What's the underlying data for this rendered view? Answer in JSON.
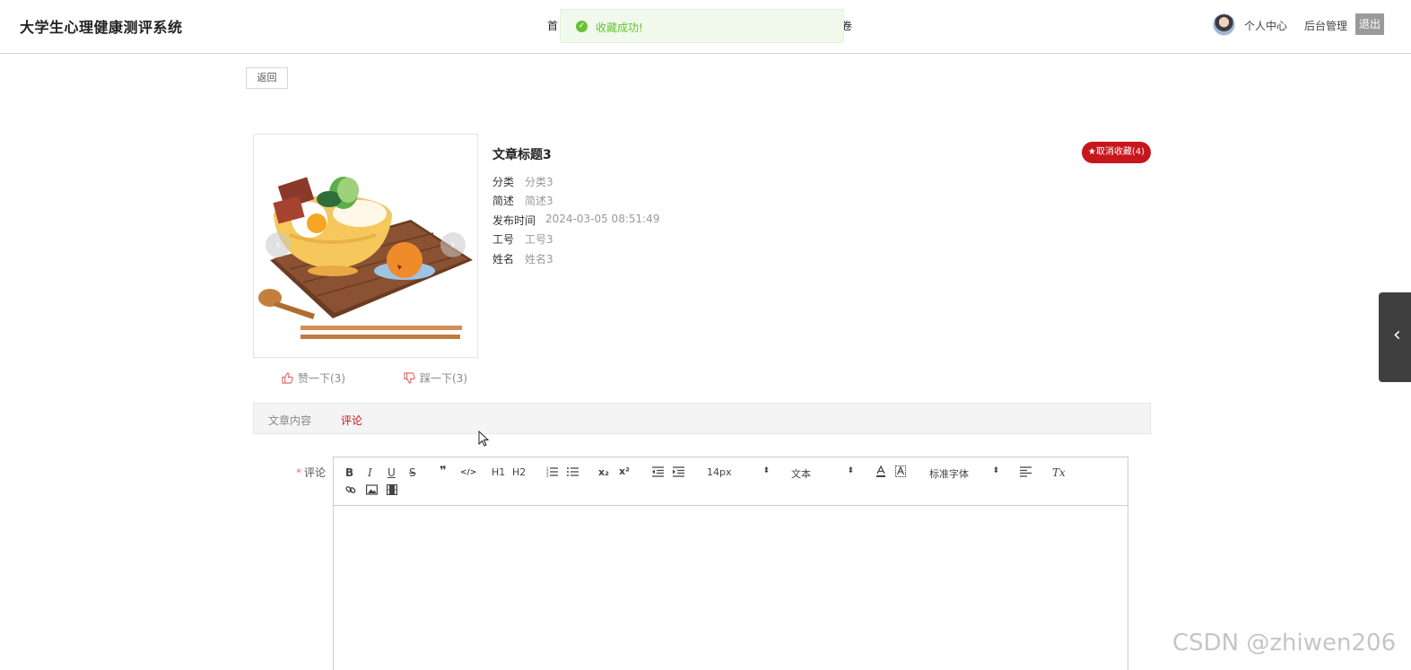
{
  "header": {
    "site_title": "大学生心理健康测评系统",
    "nav_left_fragment": "首",
    "nav_right_fragment": "卷",
    "profile_label": "个人中心",
    "admin_label": "后台管理",
    "logout_label": "退出"
  },
  "toast": {
    "icon": "check-circle-icon",
    "message": "收藏成功!"
  },
  "back_label": "返回",
  "article": {
    "title": "文章标题3",
    "favorite_badge": "★取消收藏(4)",
    "fields": [
      {
        "label": "分类",
        "value": "分类3"
      },
      {
        "label": "简述",
        "value": "简述3"
      },
      {
        "label": "发布时间",
        "value": "2024-03-05 08:51:49"
      },
      {
        "label": "工号",
        "value": "工号3"
      },
      {
        "label": "姓名",
        "value": "姓名3"
      }
    ]
  },
  "votes": {
    "up_label": "赞一下(3)",
    "down_label": "踩一下(3)"
  },
  "tabs": [
    {
      "label": "文章内容",
      "active": false
    },
    {
      "label": "评论",
      "active": true
    }
  ],
  "comment_form": {
    "label": "评论",
    "required_mark": "*",
    "toolbar": {
      "font_size": "14px",
      "paragraph": "文本",
      "font_family": "标准字体",
      "h1": "H1",
      "h2": "H2",
      "bold": "B",
      "italic": "I",
      "underline": "U",
      "strike": "S",
      "quote": "❞",
      "code": "</>",
      "subscript": "x₂",
      "superscript": "x²",
      "clear": "Tx"
    }
  },
  "watermark": "CSDN @zhiwen206",
  "colors": {
    "accent_red": "#c8161d",
    "success_green": "#67c23a",
    "logout_gray": "#9a9a9a"
  }
}
